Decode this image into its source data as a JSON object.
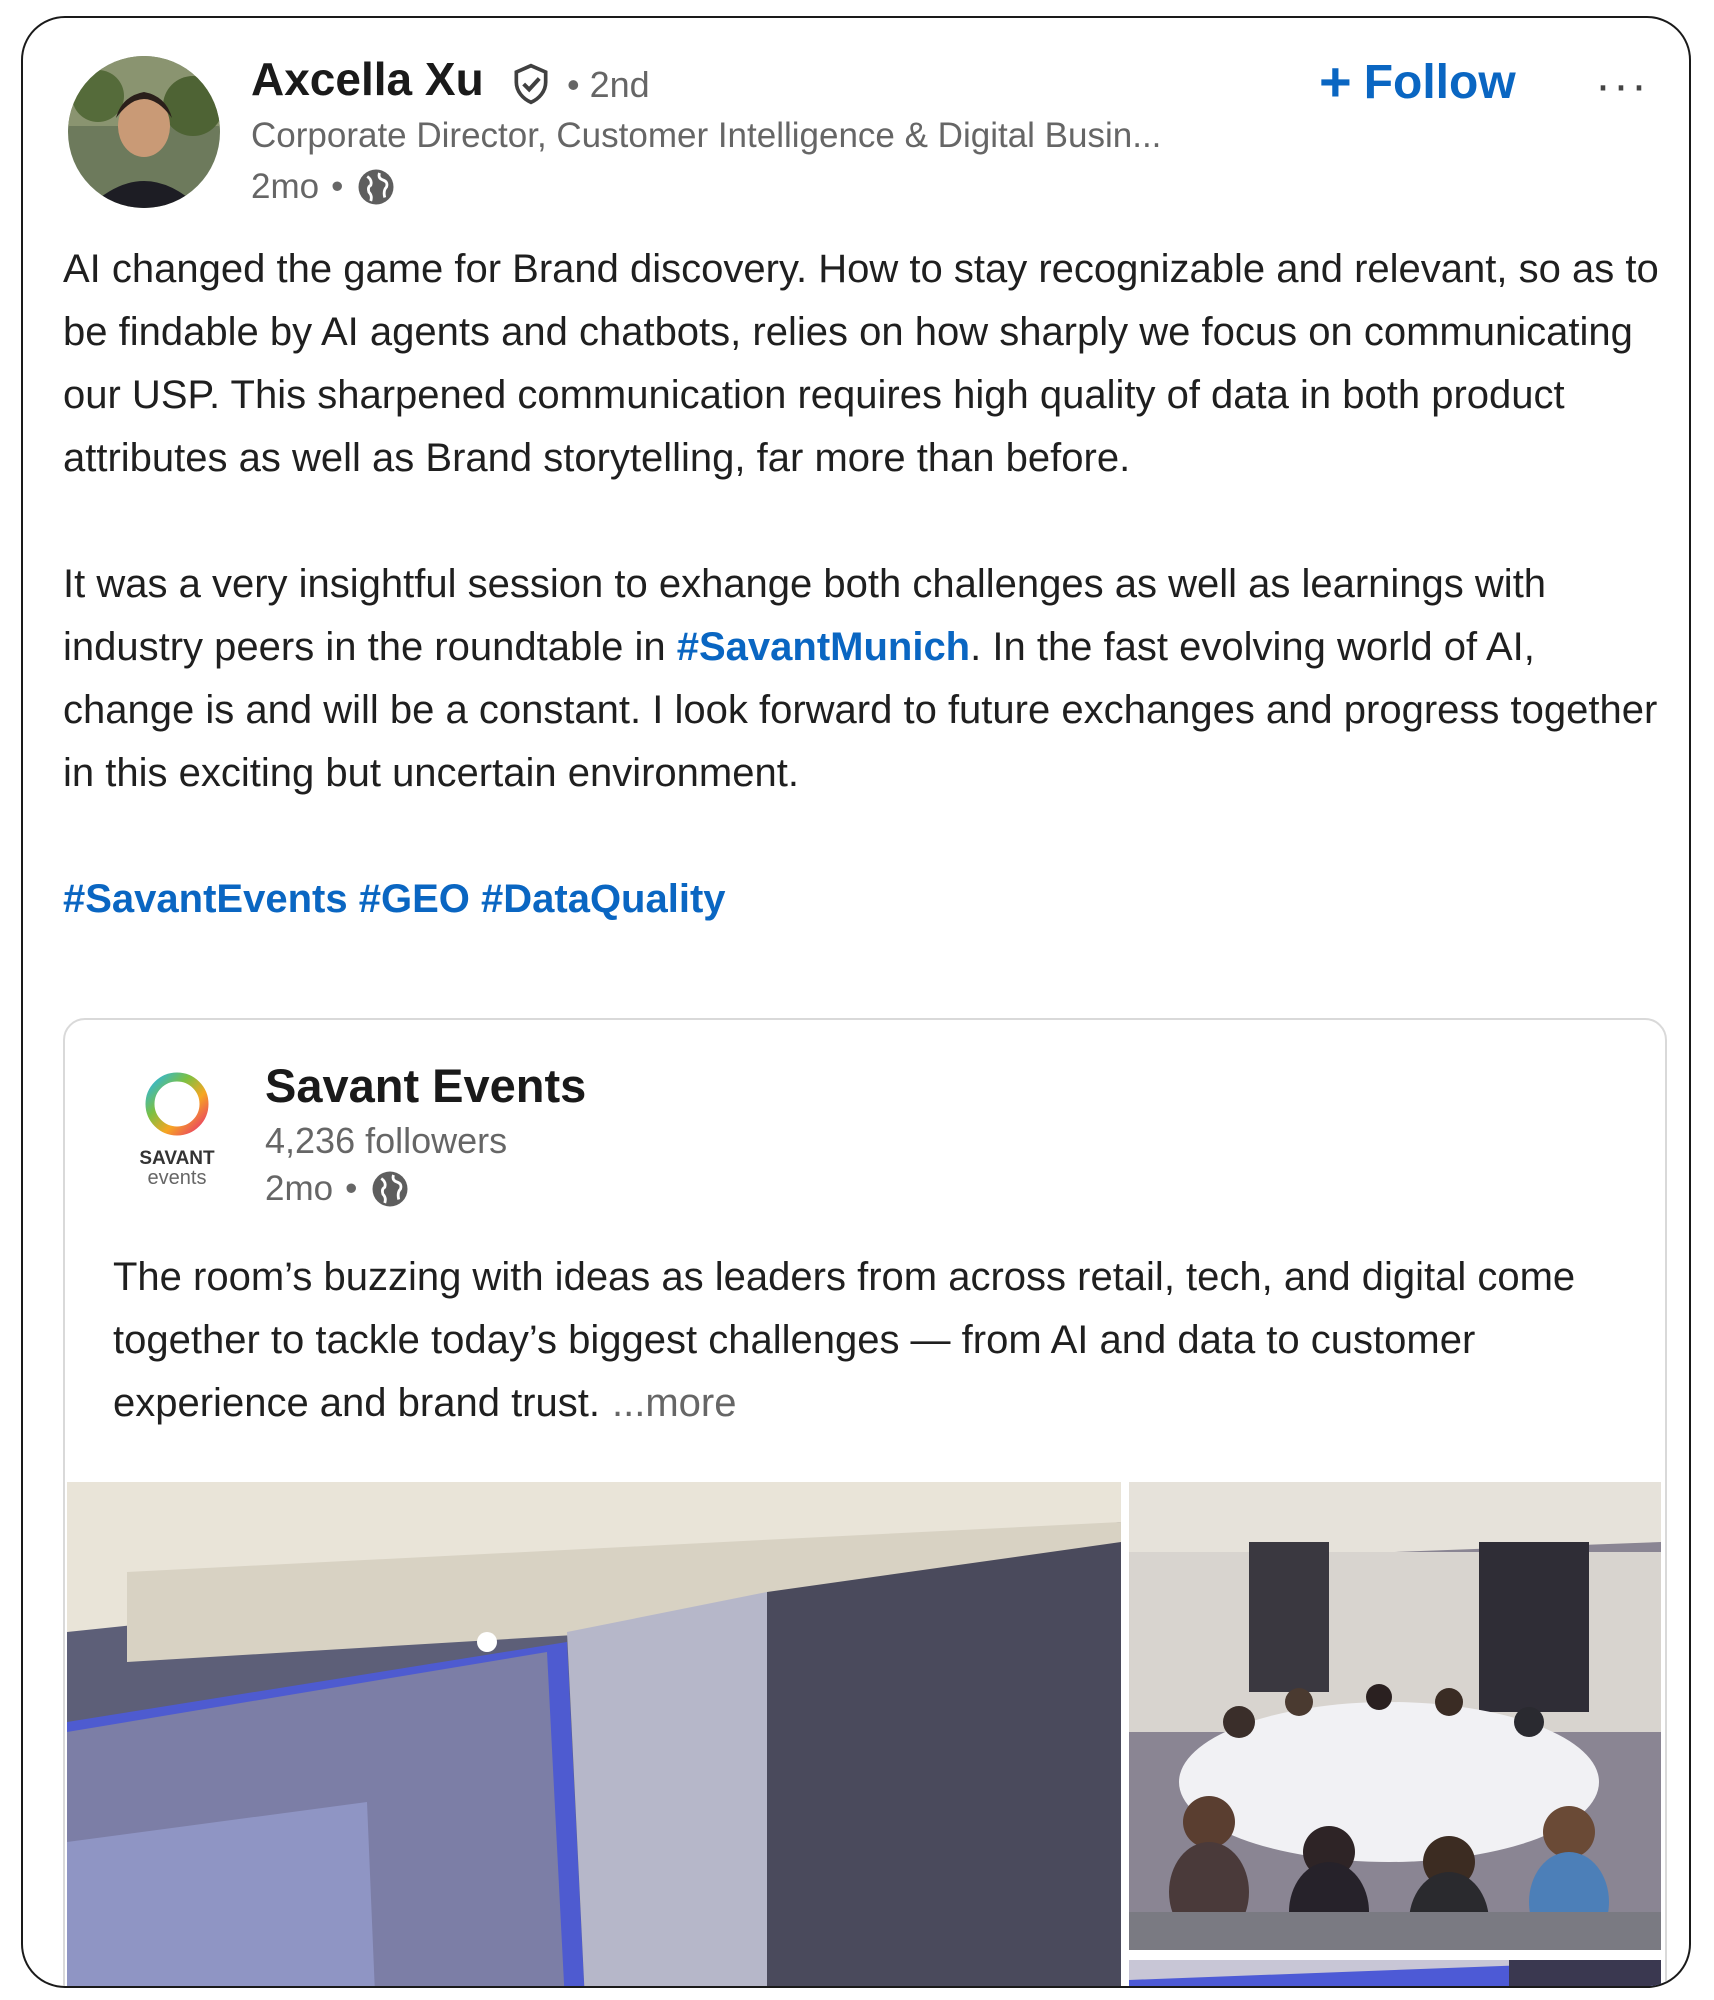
{
  "post": {
    "author_name": "Axcella Xu",
    "degree": "• 2nd",
    "headline": "Corporate Director, Customer Intelligence & Digital Busin...",
    "time": "2mo",
    "meta_dot": "•",
    "follow_label": "Follow",
    "more_menu": "···",
    "paragraph1": "AI changed the game for Brand discovery. How to stay recognizable and relevant, so as to be findable by AI agents and chatbots, relies on how sharply we focus on communicating our USP. This sharpened communication requires high quality of data in both product attributes as well as Brand storytelling, far more than before.",
    "paragraph2_before": "It was a very insightful session to exhange both challenges as well as learnings with industry peers in the roundtable in ",
    "paragraph2_hashtag": "#SavantMunich",
    "paragraph2_after": ". In the fast evolving world of AI, change is and will be a constant. I look forward to future exchanges and progress together in this exciting but uncertain environment.",
    "hashtags": [
      "#SavantEvents",
      "#GEO",
      "#DataQuality"
    ]
  },
  "shared_post": {
    "org_name": "Savant Events",
    "logo_word1": "SAVANT",
    "logo_word2": "events",
    "followers": "4,236 followers",
    "time": "2mo",
    "meta_dot": "•",
    "text": "The room’s buzzing with ideas as leaders from across retail, tech, and digital come together to tackle today’s biggest challenges — from AI and data to customer experience and brand trust.",
    "see_more": "...more"
  },
  "colors": {
    "link": "#0a66c2",
    "muted": "#666666",
    "text": "#1f1f1f"
  },
  "icons": {
    "verified": "verified-shield-icon",
    "globe": "globe-icon",
    "more": "more-horizontal-icon"
  }
}
